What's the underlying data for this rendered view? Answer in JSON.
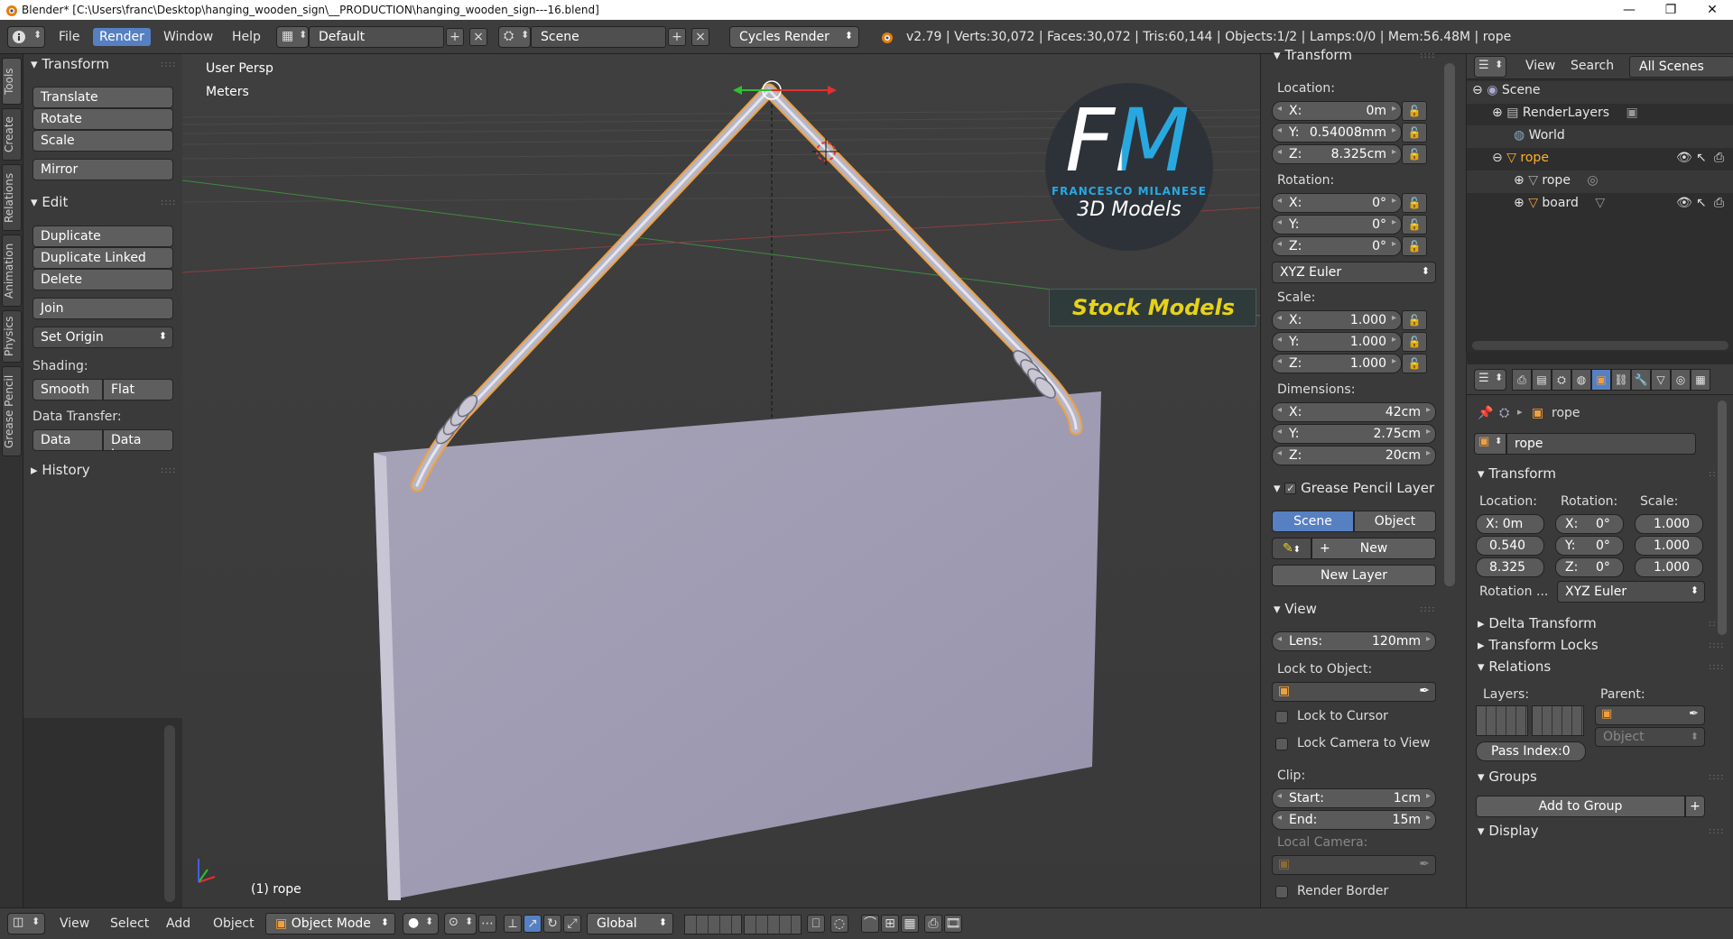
{
  "window": {
    "title": "Blender* [C:\\Users\\franc\\Desktop\\hanging_wooden_sign\\__PRODUCTION\\hanging_wooden_sign---16.blend]",
    "minimize": "—",
    "maximize": "❐",
    "close": "✕"
  },
  "info_header": {
    "menus": [
      "File",
      "Render",
      "Window",
      "Help"
    ],
    "active_menu": "Render",
    "layout": "Default",
    "scene": "Scene",
    "engine": "Cycles Render",
    "stats": "v2.79 | Verts:30,072 | Faces:30,072 | Tris:60,144 | Objects:1/2 | Lamps:0/0 | Mem:56.48M | rope"
  },
  "left_tabs": [
    "Tools",
    "Create",
    "Relations",
    "Animation",
    "Physics",
    "Grease Pencil"
  ],
  "tool_shelf": {
    "transform": {
      "title": "Transform",
      "buttons": [
        "Translate",
        "Rotate",
        "Scale",
        "Mirror"
      ]
    },
    "edit": {
      "title": "Edit",
      "buttons": [
        "Duplicate",
        "Duplicate Linked",
        "Delete",
        "Join"
      ],
      "set_origin": "Set Origin",
      "shading_label": "Shading:",
      "smooth": "Smooth",
      "flat": "Flat",
      "data_transfer_label": "Data Transfer:",
      "data": "Data",
      "data_layout": "Data Layo"
    },
    "history": "History"
  },
  "viewport": {
    "view_name": "User Persp",
    "units": "Meters",
    "object_label": "(1) rope",
    "logo": {
      "initials": "FM",
      "name": "FRANCESCO MILANESE",
      "tagline": "3D Models",
      "banner": "Stock Models"
    }
  },
  "n_panel": {
    "transform_title": "Transform",
    "location_label": "Location:",
    "location": {
      "x": "0m",
      "y": "0.54008mm",
      "z": "8.325cm"
    },
    "rotation_label": "Rotation:",
    "rotation": {
      "x": "0°",
      "y": "0°",
      "z": "0°"
    },
    "rotation_mode": "XYZ Euler",
    "scale_label": "Scale:",
    "scale": {
      "x": "1.000",
      "y": "1.000",
      "z": "1.000"
    },
    "dimensions_label": "Dimensions:",
    "dimensions": {
      "x": "42cm",
      "y": "2.75cm",
      "z": "20cm"
    },
    "axis": {
      "x": "X:",
      "y": "Y:",
      "z": "Z:"
    },
    "grease_pencil_title": "Grease Pencil Layer",
    "gp_scene": "Scene",
    "gp_object": "Object",
    "gp_new": "New",
    "gp_new_layer": "New Layer",
    "view_title": "View",
    "lens_label": "Lens:",
    "lens_value": "120mm",
    "lock_to_object": "Lock to Object:",
    "lock_to_cursor": "Lock to Cursor",
    "lock_camera": "Lock Camera to View",
    "clip_label": "Clip:",
    "clip_start_label": "Start:",
    "clip_start": "1cm",
    "clip_end_label": "End:",
    "clip_end": "15m",
    "local_camera": "Local Camera:",
    "render_border": "Render Border"
  },
  "outliner": {
    "menus": [
      "View",
      "Search"
    ],
    "filter": "All Scenes",
    "rows": [
      {
        "label": "Scene"
      },
      {
        "label": "RenderLayers"
      },
      {
        "label": "World"
      },
      {
        "label": "rope"
      },
      {
        "label": "rope"
      },
      {
        "label": "board"
      }
    ]
  },
  "properties": {
    "breadcrumb": "rope",
    "object_name": "rope",
    "transform_title": "Transform",
    "location_label": "Location:",
    "rotation_label": "Rotation:",
    "scale_label": "Scale:",
    "location": [
      "X: 0m",
      "0.540",
      "8.325"
    ],
    "rotation": [
      "X:",
      "Y:",
      "Z:"
    ],
    "rotation_values": [
      "0°",
      "0°",
      "0°"
    ],
    "scale": [
      "1.000",
      "1.000",
      "1.000"
    ],
    "rotation_mode_label": "Rotation ...",
    "rotation_mode": "XYZ Euler",
    "delta_transform": "Delta Transform",
    "transform_locks": "Transform Locks",
    "relations": "Relations",
    "layers_label": "Layers:",
    "parent_label": "Parent:",
    "parent_type": "Object",
    "pass_index": "Pass Index:0",
    "groups": "Groups",
    "add_to_group": "Add to Group",
    "display": "Display"
  },
  "bottom_header": {
    "menus": [
      "View",
      "Select",
      "Add",
      "Object"
    ],
    "mode": "Object Mode",
    "orientation": "Global"
  },
  "colors": {
    "accent": "#5680c2",
    "selected": "#ffaf29",
    "viewport_bg": "#3d3d3d",
    "logo_blue": "#29a8e0",
    "logo_yellow": "#e7d21a"
  }
}
